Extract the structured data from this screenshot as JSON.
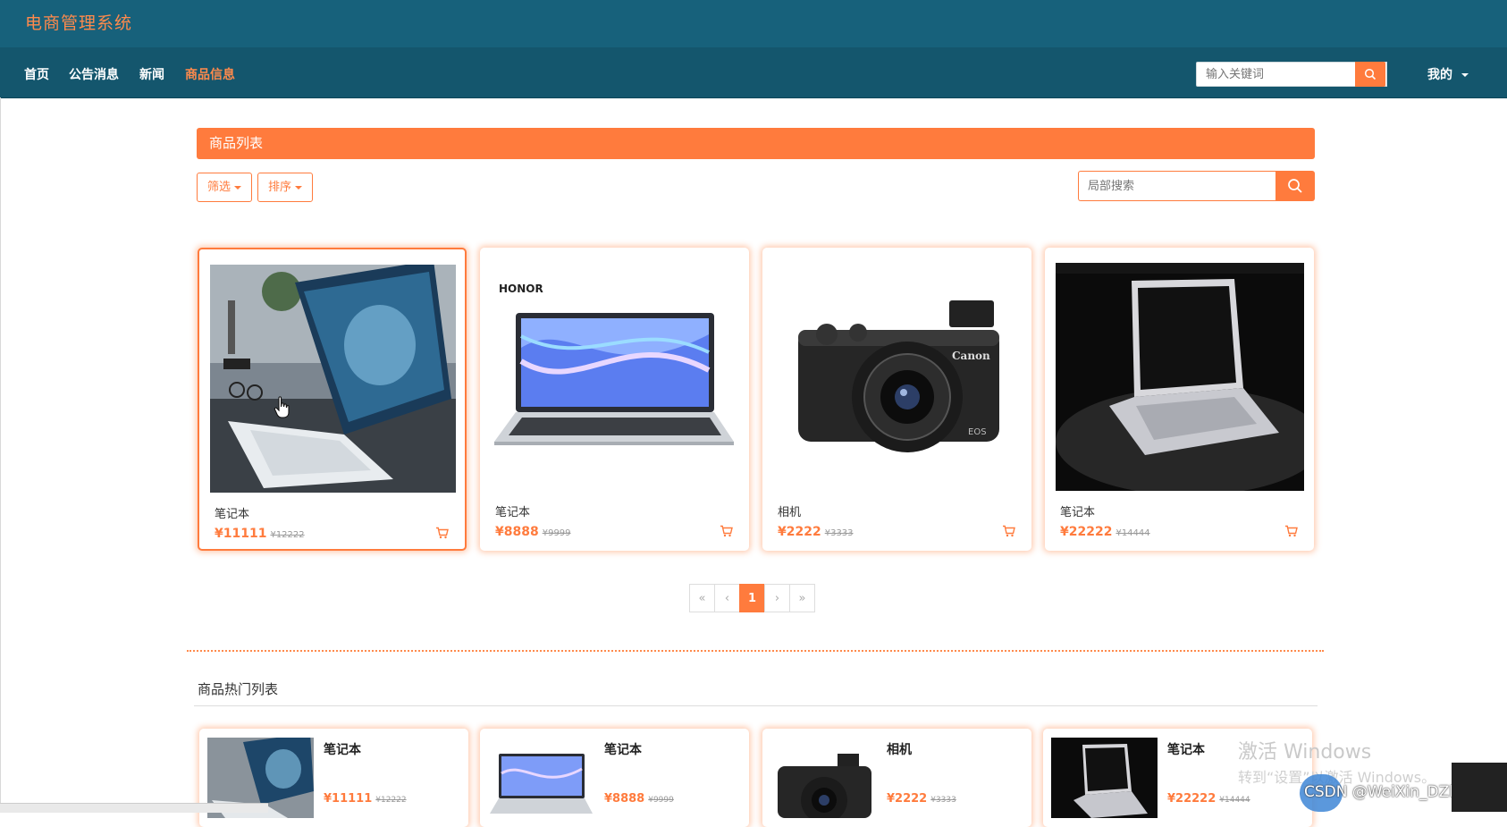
{
  "header": {
    "brand": "电商管理系统",
    "nav": [
      "首页",
      "公告消息",
      "新闻",
      "商品信息"
    ],
    "search_placeholder": "输入关键词",
    "user_menu": "我的"
  },
  "products_section": {
    "title": "商品列表",
    "filter_label": "筛选",
    "sort_label": "排序",
    "search_placeholder": "局部搜索",
    "items": [
      {
        "name": "笔记本",
        "price": "¥11111",
        "old_price": "¥12222"
      },
      {
        "name": "笔记本",
        "price": "¥8888",
        "old_price": "¥9999"
      },
      {
        "name": "相机",
        "price": "¥2222",
        "old_price": "¥3333"
      },
      {
        "name": "笔记本",
        "price": "¥22222",
        "old_price": "¥14444"
      }
    ],
    "product_image_texts": {
      "honor": "HONOR",
      "canon": "Canon",
      "eos": "EOS"
    },
    "pagination": {
      "first": "«",
      "prev": "‹",
      "current": "1",
      "next": "›",
      "last": "»"
    }
  },
  "hot_section": {
    "title": "商品热门列表",
    "items": [
      {
        "name": "笔记本",
        "price": "¥11111",
        "old_price": "¥12222"
      },
      {
        "name": "笔记本",
        "price": "¥8888",
        "old_price": "¥9999"
      },
      {
        "name": "相机",
        "price": "¥2222",
        "old_price": "¥3333"
      },
      {
        "name": "笔记本",
        "price": "¥22222",
        "old_price": "¥14444"
      }
    ]
  },
  "overlay": {
    "watermark_line1": "激活 Windows",
    "watermark_line2": "转到“设置”以激活 Windows。",
    "csdn_credit": "CSDN @WeiXin_DZbishe"
  },
  "colors": {
    "header_bg": "#17617b",
    "nav_bg": "#14566d",
    "accent": "#ff7b3d"
  },
  "icons": {
    "search": "search-icon",
    "cart": "cart-icon",
    "caret": "caret-down-icon"
  }
}
